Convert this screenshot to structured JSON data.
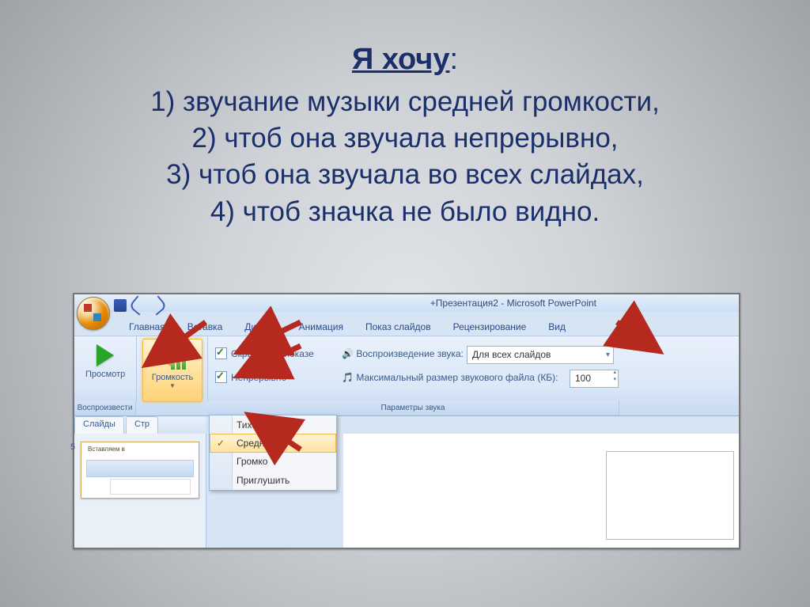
{
  "heading": {
    "title": "Я хочу",
    "colon": ":"
  },
  "lines": [
    "1) звучание музыки средней громкости,",
    "2) чтоб она звучала непрерывно,",
    "3) чтоб она звучала во всех слайдах,",
    "4) чтоб значка не было видно."
  ],
  "window": {
    "title": "+Презентация2 - Microsoft PowerPoint"
  },
  "tabs": [
    "Главная",
    "Вставка",
    "Дизайн",
    "Анимация",
    "Показ слайдов",
    "Рецензирование",
    "Вид"
  ],
  "groups": {
    "play": "Воспроизвести",
    "params": "Параметры звука"
  },
  "buttons": {
    "preview": "Просмотр",
    "volume": "Громкость"
  },
  "checks": {
    "hide": "Скрыть при показе",
    "loop": "Непрерывно"
  },
  "labels": {
    "playSound": "Воспроизведение звука:",
    "maxSize": "Максимальный размер звукового файла (КБ):"
  },
  "combos": {
    "playWhere": "Для всех слайдов",
    "maxSize": "100"
  },
  "menu": [
    "Тихо",
    "Средне",
    "Громко",
    "Приглушить"
  ],
  "selected_menu": 1,
  "panes": [
    "Слайды",
    "Стр"
  ],
  "thumb_text": "Вставляем в"
}
